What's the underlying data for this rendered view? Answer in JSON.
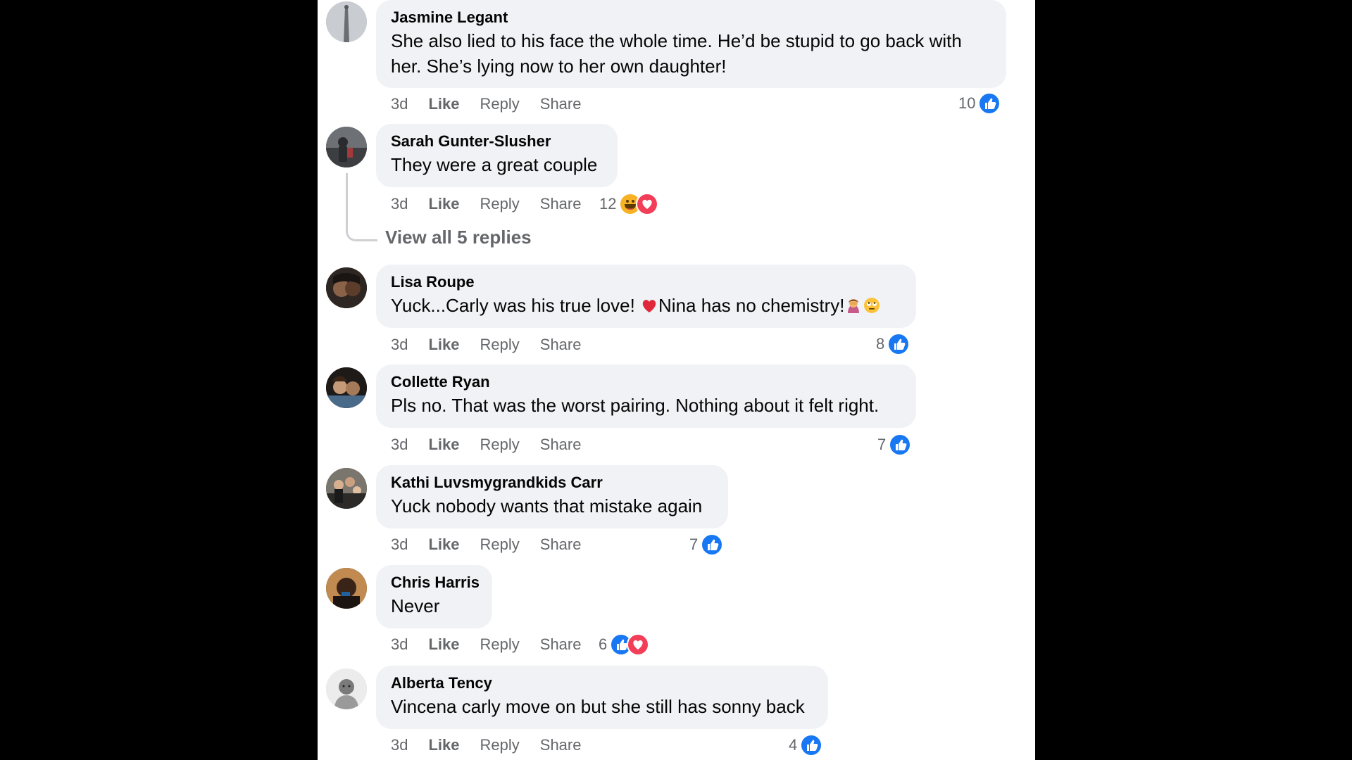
{
  "colors": {
    "background": "#000000",
    "panel": "#ffffff",
    "bubble": "#f0f2f5",
    "like_blue": "#1877f2",
    "love_red": "#f33e58",
    "haha_yellow": "#f7b125",
    "meta_gray": "#65676b"
  },
  "actions": {
    "like": "Like",
    "reply": "Reply",
    "share": "Share"
  },
  "comments": [
    {
      "author": "Jasmine Legant",
      "text_line1": "She also lied to his face the whole time. He’d be stupid to go back with",
      "text_line2": "her. She’s lying now to her own daughter!",
      "time": "3d",
      "reaction_count": "10",
      "reactions": [
        "like-icon"
      ]
    },
    {
      "author": "Sarah Gunter-Slusher",
      "text": "They were a great couple",
      "time": "3d",
      "reaction_count": "12",
      "reactions": [
        "haha-icon",
        "love-icon"
      ],
      "view_replies": "View all 5 replies"
    },
    {
      "author": "Lisa Roupe",
      "text_a": "Yuck...Carly was his true love! ",
      "text_b": "Nina has no chemistry!",
      "emojis": [
        "red-heart-emoji",
        "woman-facepalming-emoji",
        "rolling-eyes-emoji"
      ],
      "time": "3d",
      "reaction_count": "8",
      "reactions": [
        "like-icon"
      ]
    },
    {
      "author": "Collette Ryan",
      "text": "Pls no. That was the worst pairing. Nothing about it felt right.",
      "time": "3d",
      "reaction_count": "7",
      "reactions": [
        "like-icon"
      ]
    },
    {
      "author": "Kathi Luvsmygrandkids Carr",
      "text": "Yuck nobody wants that mistake again",
      "time": "3d",
      "reaction_count": "7",
      "reactions": [
        "like-icon"
      ]
    },
    {
      "author": "Chris Harris",
      "text": "Never",
      "time": "3d",
      "reaction_count": "6",
      "reactions": [
        "like-icon",
        "love-icon"
      ]
    },
    {
      "author": "Alberta Tency",
      "text": "Vincena carly move on but she still has sonny back",
      "time": "3d",
      "reaction_count": "4",
      "reactions": [
        "like-icon"
      ]
    }
  ]
}
